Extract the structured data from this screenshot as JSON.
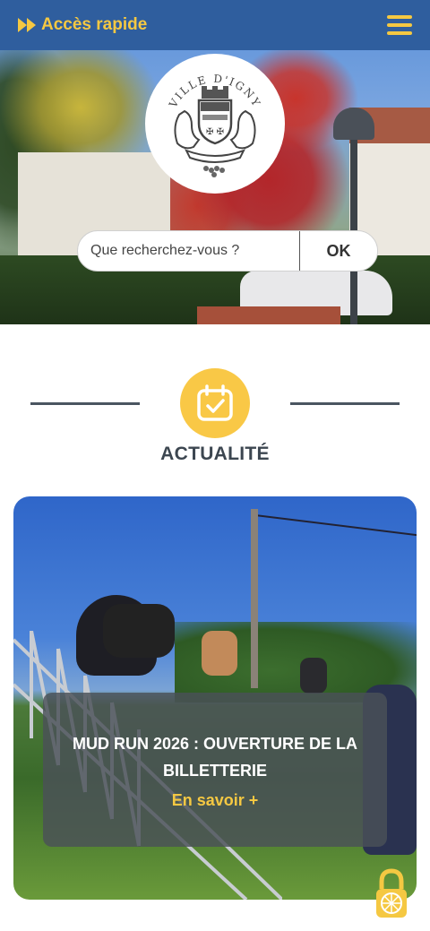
{
  "header": {
    "quick_access_label": "Accès rapide",
    "quick_access_icon": "fast-forward-icon",
    "menu_icon": "hamburger-menu-icon",
    "accent_color": "#f5c842",
    "bar_color": "#2f5e9e"
  },
  "logo": {
    "text": "VILLE D'IGNY"
  },
  "search": {
    "placeholder": "Que recherchez-vous ?",
    "button_label": "OK"
  },
  "section": {
    "icon": "calendar-check-icon",
    "title": "ACTUALITÉ"
  },
  "news": {
    "headline": "MUD RUN 2026 : OUVERTURE DE LA BILLETTERIE",
    "link_label": "En savoir +"
  },
  "accessibility": {
    "icon": "accessibility-lock-icon"
  }
}
